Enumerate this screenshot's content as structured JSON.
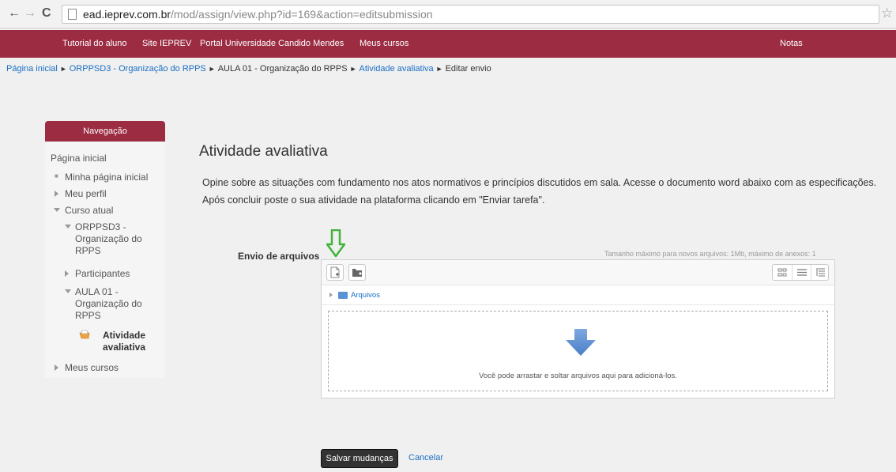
{
  "browser": {
    "back_icon": "←",
    "forward_icon": "→",
    "reload_icon": "C",
    "url_host": "ead.ieprev.com.br",
    "url_path": "/mod/assign/view.php?id=169&action=editsubmission",
    "star_icon": "☆"
  },
  "top_nav": {
    "items": [
      "Tutorial do aluno",
      "Site IEPREV",
      "Portal Universidade Candido Mendes",
      "Meus cursos"
    ],
    "right": "Notas",
    "bar_color": "#9b2c42"
  },
  "breadcrumb": {
    "items": [
      "Página inicial",
      "ORPPSD3 - Organização do RPPS",
      "AULA 01 - Organização do RPPS",
      "Atividade avaliativa",
      "Editar envio"
    ],
    "separator": "►"
  },
  "navigation": {
    "title": "Navegação",
    "home": "Página inicial",
    "my_home": "Minha página inicial",
    "profile": "Meu perfil",
    "current_course": "Curso atual",
    "course": "ORPPSD3 -\nOrganização do\nRPPS",
    "participants": "Participantes",
    "lesson": "AULA 01 -\nOrganização do\nRPPS",
    "activity": "Atividade\navaliativa",
    "my_courses": "Meus cursos"
  },
  "main": {
    "title": "Atividade avaliativa",
    "intro": "Opine sobre as situações com fundamento nos atos normativos e princípios discutidos em sala. Acesse o documento word abaixo com as especificações. Após concluir poste o sua atividade na plataforma clicando em \"Enviar tarefa\".",
    "field_label": "Envio de arquivos",
    "max_size": "Tamanho máximo para novos arquivos: 1Mb, máximo de anexos: 1",
    "folder_label": "Arquivos",
    "drop_text": "Você pode arrastar e soltar arquivos aqui para adicioná-los.",
    "save_label": "Salvar mudanças",
    "cancel_label": "Cancelar"
  }
}
